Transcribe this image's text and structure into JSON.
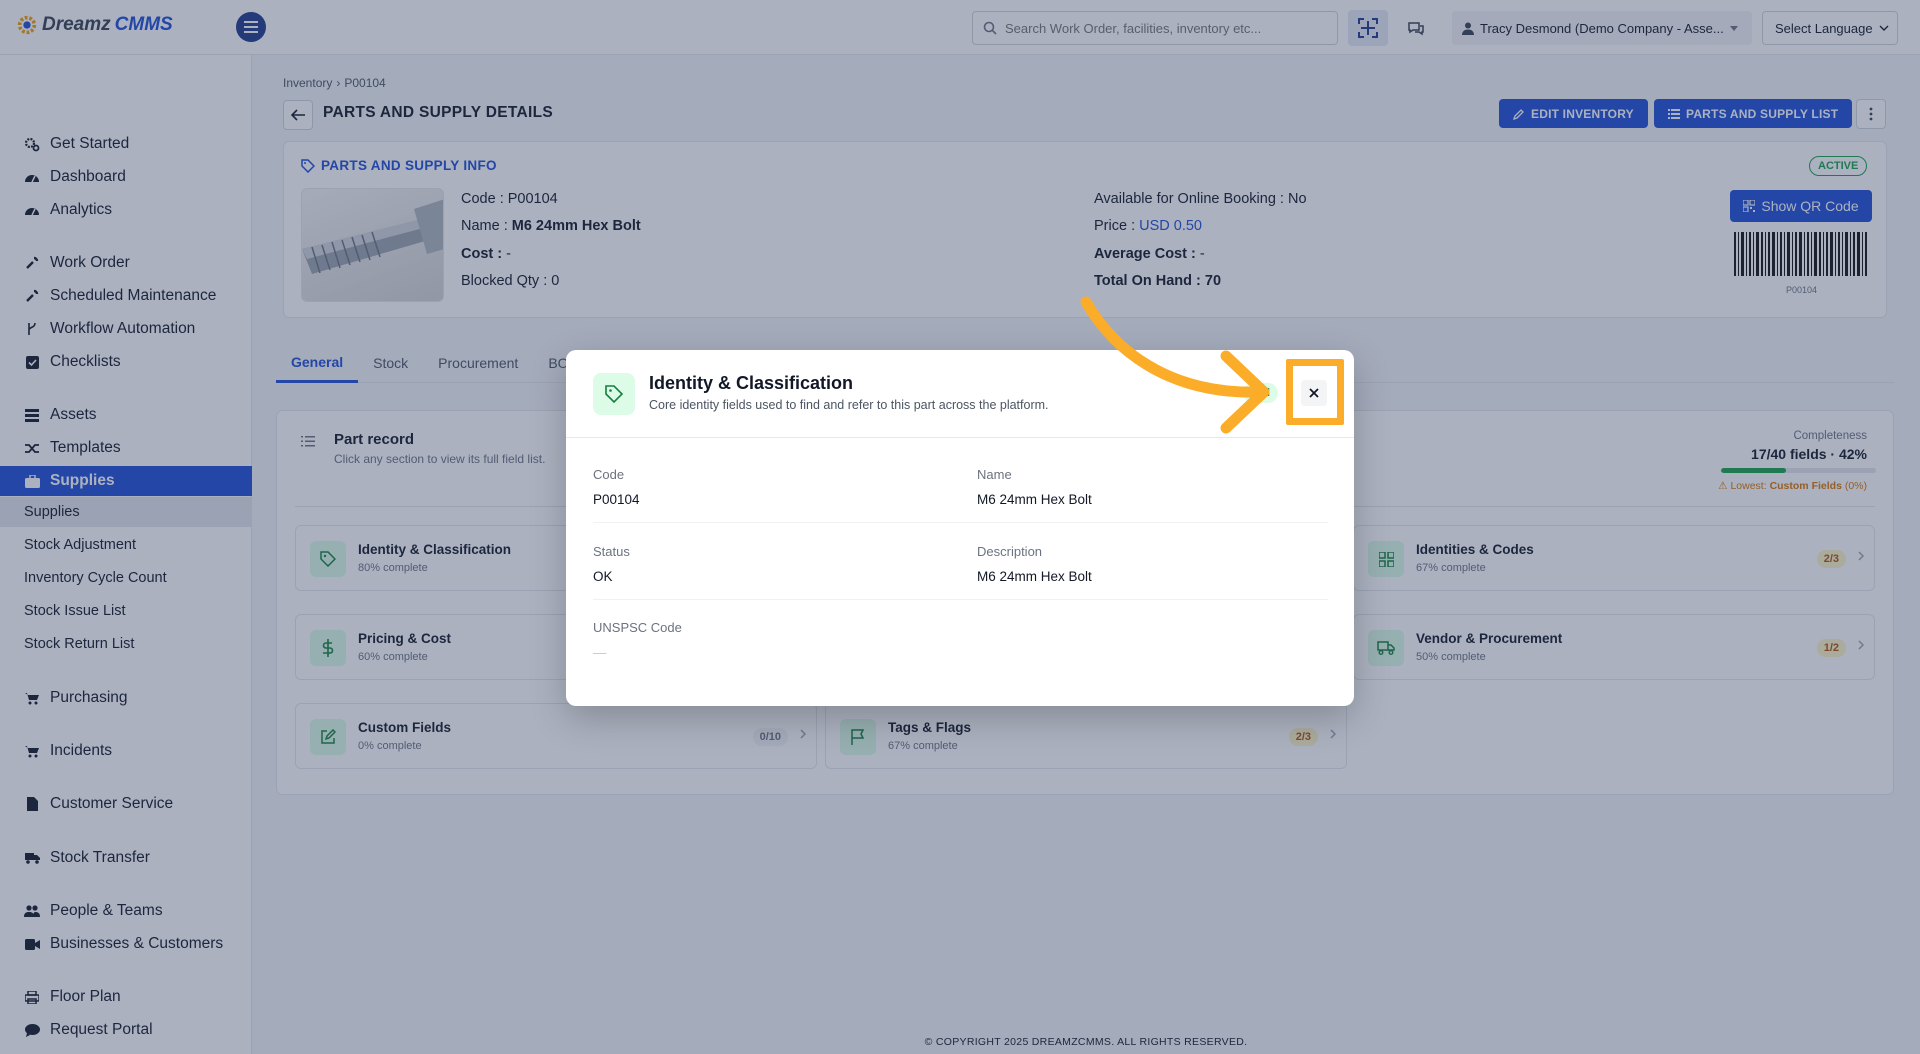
{
  "header": {
    "logo_part1": "Dreamz",
    "logo_part2": "CMMS",
    "search_placeholder": "Search Work Order, facilities, inventory etc...",
    "user": "Tracy Desmond (Demo Company - Asse...",
    "language": "Select Language"
  },
  "sidebar": {
    "items": [
      {
        "label": "Get Started",
        "icon": "gears-icon"
      },
      {
        "label": "Dashboard",
        "icon": "gauge-icon"
      },
      {
        "label": "Analytics",
        "icon": "gauge-icon"
      },
      {
        "label": "Work Order",
        "icon": "wrench-icon"
      },
      {
        "label": "Scheduled Maintenance",
        "icon": "wrench-icon"
      },
      {
        "label": "Workflow Automation",
        "icon": "branch-icon"
      },
      {
        "label": "Checklists",
        "icon": "check-square-icon"
      },
      {
        "label": "Assets",
        "icon": "building-icon"
      },
      {
        "label": "Templates",
        "icon": "shuffle-icon"
      },
      {
        "label": "Supplies",
        "icon": "briefcase-icon"
      },
      {
        "label": "Supplies"
      },
      {
        "label": "Stock Adjustment"
      },
      {
        "label": "Inventory Cycle Count"
      },
      {
        "label": "Stock Issue List"
      },
      {
        "label": "Stock Return List"
      },
      {
        "label": "Purchasing",
        "icon": "cart-icon"
      },
      {
        "label": "Incidents",
        "icon": "cart-icon"
      },
      {
        "label": "Customer Service",
        "icon": "file-icon"
      },
      {
        "label": "Stock Transfer",
        "icon": "truck-icon"
      },
      {
        "label": "People & Teams",
        "icon": "users-icon"
      },
      {
        "label": "Businesses & Customers",
        "icon": "video-icon"
      },
      {
        "label": "Floor Plan",
        "icon": "printer-icon"
      },
      {
        "label": "Request Portal",
        "icon": "comment-icon"
      }
    ]
  },
  "breadcrumb": {
    "root": "Inventory",
    "sep": "›",
    "current": "P00104"
  },
  "page": {
    "title": "PARTS AND SUPPLY DETAILS",
    "edit_btn": "EDIT INVENTORY",
    "list_btn": "PARTS AND SUPPLY LIST"
  },
  "info": {
    "title": "PARTS AND SUPPLY INFO",
    "status": "ACTIVE",
    "code_label": "Code : ",
    "code": "P00104",
    "name_label": "Name : ",
    "name": "M6 24mm Hex Bolt",
    "cost_label": "Cost : ",
    "cost": "-",
    "blocked_label": "Blocked Qty : ",
    "blocked": "0",
    "online_label": "Available for Online Booking : ",
    "online": "No",
    "price_label": "Price : ",
    "price": "USD 0.50",
    "avg_label": "Average Cost : ",
    "avg": "-",
    "onhand_label": "Total On Hand : ",
    "onhand": "70",
    "qr_btn": "Show QR Code",
    "barcode_text": "P00104"
  },
  "tabs": [
    "General",
    "Stock",
    "Procurement",
    "BO"
  ],
  "part_record": {
    "title": "Part record",
    "subtitle": "Click any section to view its full field list.",
    "completeness_label": "Completeness",
    "completeness_value": "17/40 fields · 42%",
    "completeness_fraction": 0.42,
    "lowest_prefix": "⚠ Lowest: ",
    "lowest_name": "Custom Fields",
    "lowest_pct": " (0%)"
  },
  "sections": [
    {
      "title": "Identity & Classification",
      "sub": "80% complete",
      "badge": "",
      "icon": "tag-icon"
    },
    {
      "title": "Identities & Codes",
      "sub": "67% complete",
      "badge": "2/3",
      "icon": "grid-icon"
    },
    {
      "title": "Pricing & Cost",
      "sub": "60% complete",
      "badge": "",
      "icon": "dollar-icon"
    },
    {
      "title": "Vendor & Procurement",
      "sub": "50% complete",
      "badge": "1/2",
      "icon": "truck-icon"
    },
    {
      "title": "Custom Fields",
      "sub": "0% complete",
      "badge": "0/10",
      "icon": "edit-icon"
    },
    {
      "title": "Tags & Flags",
      "sub": "67% complete",
      "badge": "2/3",
      "icon": "flag-icon"
    }
  ],
  "modal": {
    "title": "Identity & Classification",
    "subtitle": "Core identity fields used to find and refer to this part across the platform.",
    "badge": "lled",
    "close": "×",
    "fields": [
      {
        "label": "Code",
        "value": "P00104"
      },
      {
        "label": "Name",
        "value": "M6 24mm Hex Bolt"
      },
      {
        "label": "Status",
        "value": "OK"
      },
      {
        "label": "Description",
        "value": "M6 24mm Hex Bolt"
      },
      {
        "label": "UNSPSC Code",
        "value": "—"
      }
    ]
  },
  "footer": "© COPYRIGHT 2025 DREAMZCMMS. ALL RIGHTS RESERVED.",
  "colors": {
    "brand": "#1d4ed8",
    "success": "#16a34a",
    "annotation": "#fbad2a"
  }
}
